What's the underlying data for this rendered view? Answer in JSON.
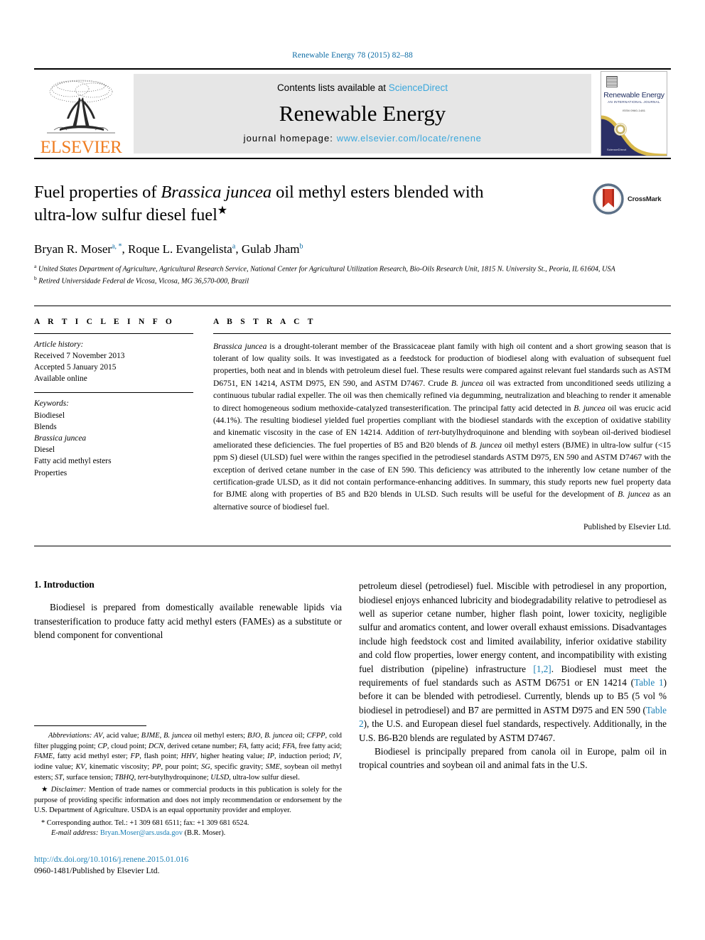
{
  "running_head": "Renewable Energy 78 (2015) 82–88",
  "masthead": {
    "publisher": "ELSEVIER",
    "contents_prefix": "Contents lists available at ",
    "sciencedirect": "ScienceDirect",
    "journal_title": "Renewable Energy",
    "homepage_label": "journal homepage: ",
    "homepage_url": "www.elsevier.com/locate/renene",
    "cover": {
      "title": "Renewable Energy",
      "subtitle": "AN INTERNATIONAL JOURNAL",
      "subtitle2": "ISSN 0960-1481",
      "footer": "ScienceDirect"
    }
  },
  "article": {
    "title_line1_pre": "Fuel properties of ",
    "title_italic": "Brassica juncea",
    "title_line1_post": " oil methyl esters blended with",
    "title_line2": "ultra-low sulfur diesel fuel",
    "title_star": "★",
    "crossmark_label": "CrossMark",
    "authors": [
      {
        "name": "Bryan R. Moser",
        "marks": "a, *"
      },
      {
        "name": "Roque L. Evangelista",
        "marks": "a"
      },
      {
        "name": "Gulab Jham",
        "marks": "b"
      }
    ],
    "affiliations": [
      {
        "mark": "a",
        "text": "United States Department of Agriculture, Agricultural Research Service, National Center for Agricultural Utilization Research, Bio-Oils Research Unit, 1815 N. University St., Peoria, IL 61604, USA"
      },
      {
        "mark": "b",
        "text": "Retired Universidade Federal de Vicosa, Vicosa, MG 36,570-000, Brazil"
      }
    ]
  },
  "article_info": {
    "heading": "A R T I C L E   I N F O",
    "history_label": "Article history:",
    "history": [
      "Received 7 November 2013",
      "Accepted 5 January 2015",
      "Available online"
    ],
    "keywords_label": "Keywords:",
    "keywords": [
      {
        "text": "Biodiesel",
        "italic": false
      },
      {
        "text": "Blends",
        "italic": false
      },
      {
        "text": "Brassica juncea",
        "italic": true
      },
      {
        "text": "Diesel",
        "italic": false
      },
      {
        "text": "Fatty acid methyl esters",
        "italic": false
      },
      {
        "text": "Properties",
        "italic": false
      }
    ]
  },
  "abstract": {
    "heading": "A B S T R A C T",
    "text_parts": [
      {
        "t": "Brassica juncea",
        "i": true
      },
      {
        "t": " is a drought-tolerant member of the Brassicaceae plant family with high oil content and a short growing season that is tolerant of low quality soils. It was investigated as a feedstock for production of biodiesel along with evaluation of subsequent fuel properties, both neat and in blends with petroleum diesel fuel. These results were compared against relevant fuel standards such as ASTM D6751, EN 14214, ASTM D975, EN 590, and ASTM D7467. Crude ",
        "i": false
      },
      {
        "t": "B. juncea",
        "i": true
      },
      {
        "t": " oil was extracted from unconditioned seeds utilizing a continuous tubular radial expeller. The oil was then chemically refined via degumming, neutralization and bleaching to render it amenable to direct homogeneous sodium methoxide-catalyzed transesterification. The principal fatty acid detected in ",
        "i": false
      },
      {
        "t": "B. juncea",
        "i": true
      },
      {
        "t": " oil was erucic acid (44.1%). The resulting biodiesel yielded fuel properties compliant with the biodiesel standards with the exception of oxidative stability and kinematic viscosity in the case of EN 14214. Addition of ",
        "i": false
      },
      {
        "t": "tert",
        "i": true
      },
      {
        "t": "-butylhydroquinone and blending with soybean oil-derived biodiesel ameliorated these deficiencies. The fuel properties of B5 and B20 blends of ",
        "i": false
      },
      {
        "t": "B. juncea",
        "i": true
      },
      {
        "t": " oil methyl esters (BJME) in ultra-low sulfur (<15 ppm S) diesel (ULSD) fuel were within the ranges specified in the petrodiesel standards ASTM D975, EN 590 and ASTM D7467 with the exception of derived cetane number in the case of EN 590. This deficiency was attributed to the inherently low cetane number of the certification-grade ULSD, as it did not contain performance-enhancing additives. In summary, this study reports new fuel property data for BJME along with properties of B5 and B20 blends in ULSD. Such results will be useful for the development of ",
        "i": false
      },
      {
        "t": "B. juncea",
        "i": true
      },
      {
        "t": " as an alternative source of biodiesel fuel.",
        "i": false
      }
    ],
    "published_by": "Published by Elsevier Ltd."
  },
  "body": {
    "section_number_title": "1. Introduction",
    "left_paragraph": "Biodiesel is prepared from domestically available renewable lipids via transesterification to produce fatty acid methyl esters (FAMEs) as a substitute or blend component for conventional",
    "right_paragraph_1_parts": [
      {
        "t": "petroleum diesel (petrodiesel) fuel. Miscible with petrodiesel in any proportion, biodiesel enjoys enhanced lubricity and biodegradability relative to petrodiesel as well as superior cetane number, higher flash point, lower toxicity, negligible sulfur and aromatics content, and lower overall exhaust emissions. Disadvantages include high feedstock cost and limited availability, inferior oxidative stability and cold flow properties, lower energy content, and incompatibility with existing fuel distribution (pipeline) infrastructure ",
        "link": false
      },
      {
        "t": "[1,2]",
        "link": true
      },
      {
        "t": ". Biodiesel must meet the requirements of fuel standards such as ASTM D6751 or EN 14214 (",
        "link": false
      },
      {
        "t": "Table 1",
        "link": true
      },
      {
        "t": ") before it can be blended with petrodiesel. Currently, blends up to B5 (5 vol % biodiesel in petrodiesel) and B7 are permitted in ASTM D975 and EN 590 (",
        "link": false
      },
      {
        "t": "Table 2",
        "link": true
      },
      {
        "t": "), the U.S. and European diesel fuel standards, respectively. Additionally, in the U.S. B6-B20 blends are regulated by ASTM D7467.",
        "link": false
      }
    ],
    "right_paragraph_2": "Biodiesel is principally prepared from canola oil in Europe, palm oil in tropical countries and soybean oil and animal fats in the U.S."
  },
  "footnotes": {
    "abbrev_label": "Abbreviations:",
    "abbrev_parts": [
      {
        "t": "AV",
        "i": true
      },
      {
        "t": ", acid value; ",
        "i": false
      },
      {
        "t": "BJME",
        "i": true
      },
      {
        "t": ", ",
        "i": false
      },
      {
        "t": "B. juncea",
        "i": true
      },
      {
        "t": " oil methyl esters; ",
        "i": false
      },
      {
        "t": "BJO",
        "i": true
      },
      {
        "t": ", ",
        "i": false
      },
      {
        "t": "B. juncea",
        "i": true
      },
      {
        "t": " oil; ",
        "i": false
      },
      {
        "t": "CFPP",
        "i": true
      },
      {
        "t": ", cold filter plugging point; ",
        "i": false
      },
      {
        "t": "CP",
        "i": true
      },
      {
        "t": ", cloud point; ",
        "i": false
      },
      {
        "t": "DCN",
        "i": true
      },
      {
        "t": ", derived cetane number; ",
        "i": false
      },
      {
        "t": "FA",
        "i": true
      },
      {
        "t": ", fatty acid; ",
        "i": false
      },
      {
        "t": "FFA",
        "i": true
      },
      {
        "t": ", free fatty acid; ",
        "i": false
      },
      {
        "t": "FAME",
        "i": true
      },
      {
        "t": ", fatty acid methyl ester; ",
        "i": false
      },
      {
        "t": "FP",
        "i": true
      },
      {
        "t": ", flash point; ",
        "i": false
      },
      {
        "t": "HHV",
        "i": true
      },
      {
        "t": ", higher heating value; ",
        "i": false
      },
      {
        "t": "IP",
        "i": true
      },
      {
        "t": ", induction period; ",
        "i": false
      },
      {
        "t": "IV",
        "i": true
      },
      {
        "t": ", iodine value; ",
        "i": false
      },
      {
        "t": "KV",
        "i": true
      },
      {
        "t": ", kinematic viscosity; ",
        "i": false
      },
      {
        "t": "PP",
        "i": true
      },
      {
        "t": ", pour point; ",
        "i": false
      },
      {
        "t": "SG",
        "i": true
      },
      {
        "t": ", specific gravity; ",
        "i": false
      },
      {
        "t": "SME",
        "i": true
      },
      {
        "t": ", soybean oil methyl esters; ",
        "i": false
      },
      {
        "t": "ST",
        "i": true
      },
      {
        "t": ", surface tension; ",
        "i": false
      },
      {
        "t": "TBHQ",
        "i": true
      },
      {
        "t": ", ",
        "i": false
      },
      {
        "t": "tert",
        "i": true
      },
      {
        "t": "-butylhydroquinone; ",
        "i": false
      },
      {
        "t": "ULSD",
        "i": true
      },
      {
        "t": ", ultra-low sulfur diesel.",
        "i": false
      }
    ],
    "disclaimer_mark": "★",
    "disclaimer_label": "Disclaimer:",
    "disclaimer": " Mention of trade names or commercial products in this publication is solely for the purpose of providing specific information and does not imply recommendation or endorsement by the U.S. Department of Agriculture. USDA is an equal opportunity provider and employer.",
    "corresponding_mark": "*",
    "corresponding": " Corresponding author. Tel.: +1 309 681 6511; fax: +1 309 681 6524.",
    "email_label": "E-mail address:",
    "email": "Bryan.Moser@ars.usda.gov",
    "email_suffix": " (B.R. Moser).",
    "doi": "http://dx.doi.org/10.1016/j.renene.2015.01.016",
    "issn": "0960-1481/Published by Elsevier Ltd."
  },
  "colors": {
    "link_blue": "#1a7fb5",
    "running_head_blue": "#0b6ba4",
    "elsevier_orange": "#ef7d21",
    "sd_blue": "#3aa7dc",
    "cover_navy": "#2b2f66"
  }
}
